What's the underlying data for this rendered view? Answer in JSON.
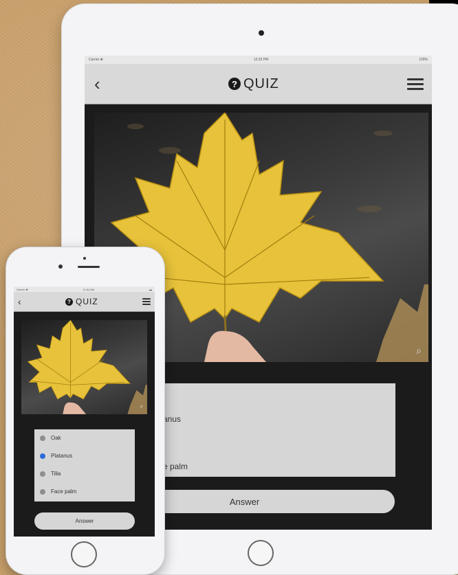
{
  "tablet": {
    "status": {
      "carrier": "Carrier ❀",
      "time": "12:33 PM",
      "battery": "100%"
    },
    "nav": {
      "title": "QUIZ",
      "logo_glyph": "?",
      "back_icon": "chevron-left-icon",
      "menu_icon": "hamburger-icon"
    },
    "options": [
      "anus",
      "e palm"
    ],
    "answer_label": "Answer",
    "zoom_icon": "magnifier-icon"
  },
  "phone": {
    "status": {
      "carrier": "Carrier ❀",
      "time": "11:54 AM",
      "battery": "▬"
    },
    "nav": {
      "title": "QUIZ",
      "logo_glyph": "?",
      "back_icon": "chevron-left-icon",
      "menu_icon": "hamburger-icon"
    },
    "options": [
      {
        "label": "Oak",
        "selected": false
      },
      {
        "label": "Platanus",
        "selected": true
      },
      {
        "label": "Tilia",
        "selected": false
      },
      {
        "label": "Face palm",
        "selected": false
      }
    ],
    "answer_label": "Answer",
    "zoom_icon": "magnifier-icon"
  },
  "colors": {
    "leaf": "#e7c23a",
    "selected_radio": "#2d6bd8",
    "screen_bg": "#1b1b1b",
    "panel_bg": "#d6d6d6"
  }
}
